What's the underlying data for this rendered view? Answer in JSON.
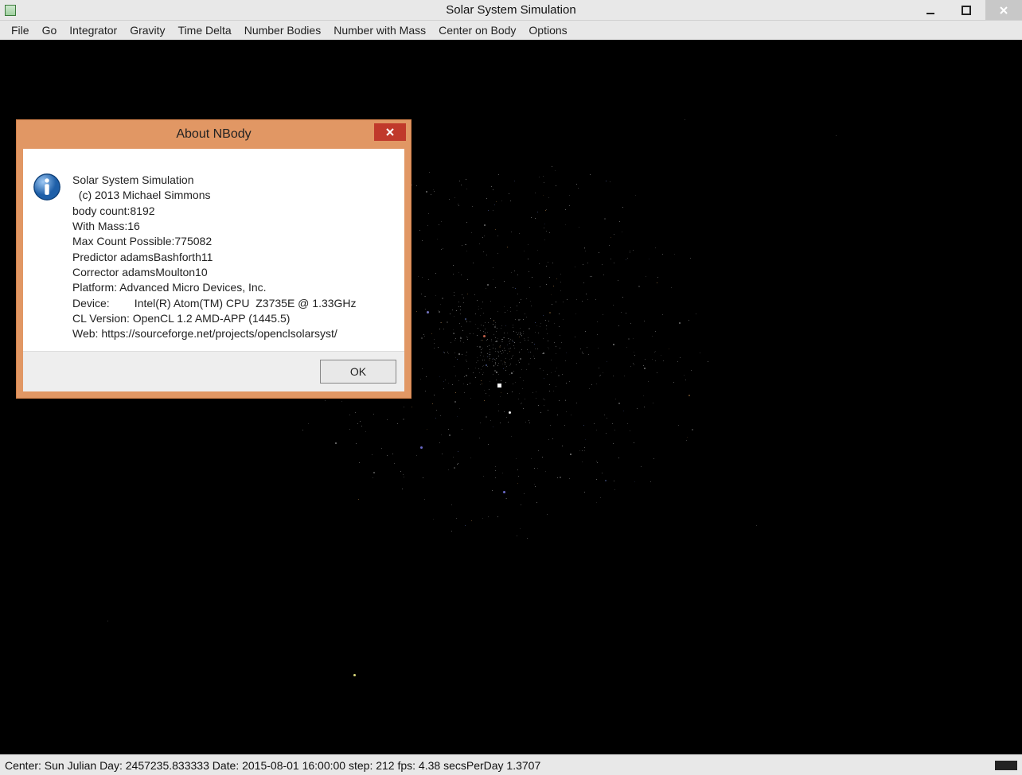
{
  "window": {
    "title": "Solar System Simulation"
  },
  "menubar": {
    "items": [
      "File",
      "Go",
      "Integrator",
      "Gravity",
      "Time Delta",
      "Number Bodies",
      "Number with Mass",
      "Center on Body",
      "Options"
    ]
  },
  "dialog": {
    "title": "About NBody",
    "ok_label": "OK",
    "lines": [
      "Solar System Simulation",
      "  (c) 2013 Michael Simmons",
      "body count:8192",
      "With Mass:16",
      "Max Count Possible:775082",
      "Predictor adamsBashforth11",
      "Corrector adamsMoulton10",
      "Platform: Advanced Micro Devices, Inc.",
      "Device:        Intel(R) Atom(TM) CPU  Z3735E @ 1.33GHz",
      "CL Version: OpenCL 1.2 AMD-APP (1445.5)",
      "Web: https://sourceforge.net/projects/openclsolarsyst/"
    ]
  },
  "status": {
    "text": "Center: Sun Julian Day: 2457235.833333 Date: 2015-08-01 16:00:00 step: 212 fps: 4.38 secsPerDay 1.3707"
  }
}
